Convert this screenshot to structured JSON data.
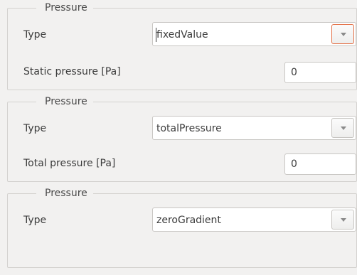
{
  "groups": [
    {
      "title": "Pressure",
      "type_label": "Type",
      "type_value": "fixedValue",
      "field_label": "Static pressure [Pa]",
      "field_value": "0"
    },
    {
      "title": "Pressure",
      "type_label": "Type",
      "type_value": "totalPressure",
      "field_label": "Total pressure [Pa]",
      "field_value": "0"
    },
    {
      "title": "Pressure",
      "type_label": "Type",
      "type_value": "zeroGradient"
    }
  ],
  "icons": {
    "dropdown": "chevron-down-icon"
  },
  "colors": {
    "background": "#f2f1f0",
    "focus_accent": "#e4734a",
    "border": "#d4d2cf"
  }
}
